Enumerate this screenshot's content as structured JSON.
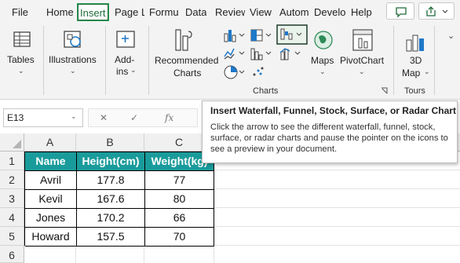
{
  "menu": {
    "tabs": [
      "File",
      "Home",
      "Insert",
      "Page L",
      "Formu",
      "Data",
      "Review",
      "View",
      "Autom",
      "Develo",
      "Help"
    ],
    "active_tab": "Insert"
  },
  "ribbon": {
    "tables": "Tables",
    "illustrations": "Illustrations",
    "addins_line1": "Add-",
    "addins_line2": "ins",
    "recommended_line1": "Recommended",
    "recommended_line2": "Charts",
    "maps": "Maps",
    "pivotchart": "PivotChart",
    "map3d_line1": "3D",
    "map3d_line2": "Map",
    "charts_group": "Charts",
    "tours_group": "Tours"
  },
  "formula_bar": {
    "name_box": "E13",
    "cancel_symbol": "✕",
    "enter_symbol": "✓",
    "fx_symbol": "fx"
  },
  "tooltip": {
    "title": "Insert Waterfall, Funnel, Stock, Surface, or Radar Chart",
    "body": "Click the arrow to see the different waterfall, funnel, stock, surface, or radar charts and pause the pointer on the icons to see a preview in your document."
  },
  "sheet": {
    "columns": [
      "A",
      "B",
      "C"
    ],
    "rows": [
      "1",
      "2",
      "3",
      "4",
      "5",
      "6"
    ],
    "headers": [
      "Name",
      "Height(cm)",
      "Weight(kg)"
    ],
    "data": [
      [
        "Avril",
        "177.8",
        "77"
      ],
      [
        "Kevil",
        "167.6",
        "80"
      ],
      [
        "Jones",
        "170.2",
        "66"
      ],
      [
        "Howard",
        "157.5",
        "70"
      ]
    ],
    "header_color": "#1a9b9b"
  },
  "colors": {
    "accent": "#1e6b3a"
  }
}
